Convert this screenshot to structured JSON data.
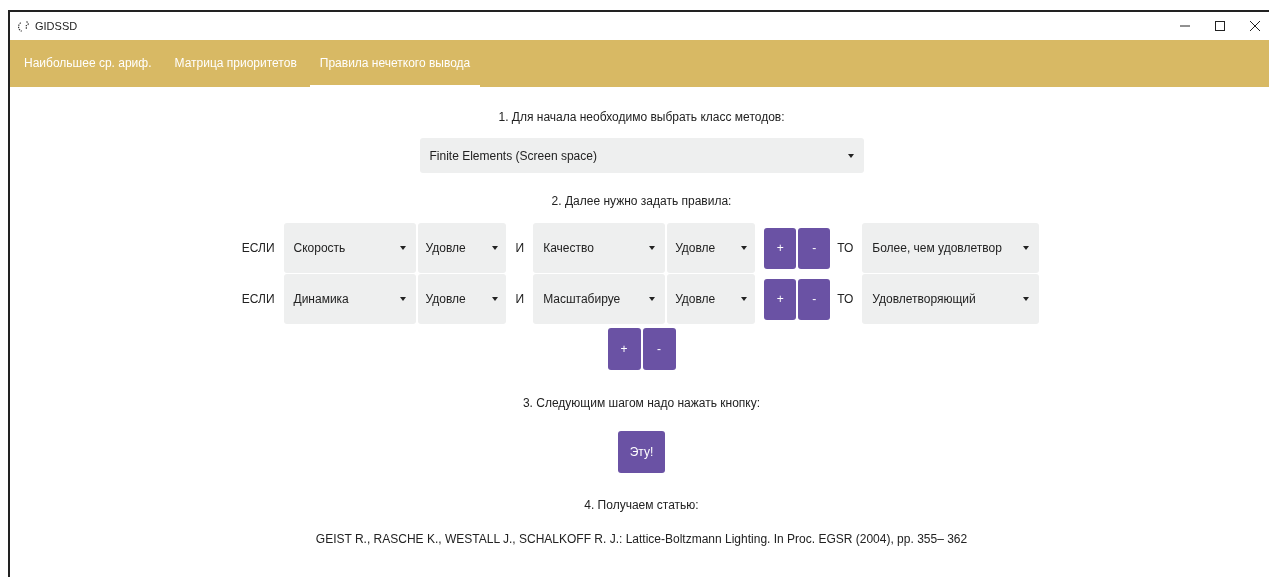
{
  "window": {
    "title": "GIDSSD"
  },
  "tabs": [
    {
      "label": "Наибольшее ср. ариф.",
      "selected": false
    },
    {
      "label": "Матрица приоритетов",
      "selected": false
    },
    {
      "label": "Правила нечеткого вывода",
      "selected": true
    }
  ],
  "step1": {
    "label": "1. Для начала необходимо выбрать класс методов:",
    "method": "Finite Elements (Screen space)"
  },
  "step2": {
    "label": "2. Далее нужно задать правила:"
  },
  "rules": [
    {
      "if": "ЕСЛИ",
      "param1": "Скорость",
      "value1": "Удовле",
      "and": "И",
      "param2": "Качество",
      "value2": "Удовле",
      "add": "+",
      "remove": "-",
      "then": "ТО",
      "result": "Более, чем удовлетвор"
    },
    {
      "if": "ЕСЛИ",
      "param1": "Динамика",
      "value1": "Удовле",
      "and": "И",
      "param2": "Масштабируе",
      "value2": "Удовле",
      "add": "+",
      "remove": "-",
      "then": "ТО",
      "result": "Удовлетворяющий"
    }
  ],
  "rule_buttons": {
    "add": "+",
    "remove": "-"
  },
  "step3": {
    "label": "3. Следующим шагом надо нажать кнопку:",
    "button": "Эту!"
  },
  "step4": {
    "label": "4. Получаем статью:",
    "citation": "GEIST R., RASCHE K., WESTALL J., SCHALKOFF R. J.: Lattice-Boltzmann Lighting. In Proc. EGSR (2004), pp. 355– 362"
  }
}
